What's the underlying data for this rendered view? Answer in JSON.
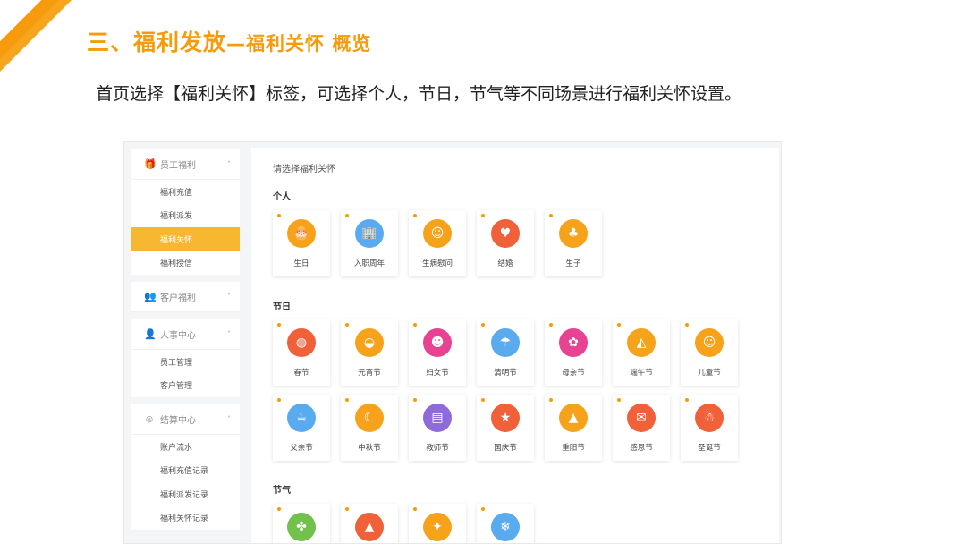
{
  "header": {
    "title_main": "三、福利发放",
    "title_sub": "—福利关怀 概览",
    "description": "首页选择【福利关怀】标签，可选择个人，节日，节气等不同场景进行福利关怀设置。"
  },
  "sidebar": {
    "groups": [
      {
        "label": "员工福利",
        "icon": "gift-icon",
        "chevron": "˄",
        "items": [
          "福利充值",
          "福利派发",
          "福利关怀",
          "福利授信"
        ]
      },
      {
        "label": "客户福利",
        "icon": "users-icon",
        "chevron": "˅",
        "items": []
      },
      {
        "label": "人事中心",
        "icon": "person-icon",
        "chevron": "˄",
        "items": [
          "员工管理",
          "客户管理"
        ]
      },
      {
        "label": "结算中心",
        "icon": "coin-icon",
        "chevron": "˄",
        "items": [
          "账户流水",
          "福利充值记录",
          "福利派发记录",
          "福利关怀记录"
        ]
      }
    ],
    "active_item": "福利关怀"
  },
  "content": {
    "prompt": "请选择福利关怀",
    "sections": [
      {
        "label": "个人",
        "cards": [
          {
            "name": "生日",
            "color": "#f7a21b",
            "glyph": "🎂"
          },
          {
            "name": "入职周年",
            "color": "#5aaaf0",
            "glyph": "🏢"
          },
          {
            "name": "生病慰问",
            "color": "#f7a21b",
            "glyph": "☺"
          },
          {
            "name": "结婚",
            "color": "#f0613a",
            "glyph": "♥"
          },
          {
            "name": "生子",
            "color": "#f7a21b",
            "glyph": "♣"
          }
        ]
      },
      {
        "label": "节日",
        "cards": [
          {
            "name": "春节",
            "color": "#f0613a",
            "glyph": "◍"
          },
          {
            "name": "元宵节",
            "color": "#f7a21b",
            "glyph": "◒"
          },
          {
            "name": "妇女节",
            "color": "#e84393",
            "glyph": "☻"
          },
          {
            "name": "清明节",
            "color": "#5aaaf0",
            "glyph": "☂"
          },
          {
            "name": "母亲节",
            "color": "#e84393",
            "glyph": "✿"
          },
          {
            "name": "端午节",
            "color": "#f7a21b",
            "glyph": "◭"
          },
          {
            "name": "儿童节",
            "color": "#f7a21b",
            "glyph": "☺"
          },
          {
            "name": "父亲节",
            "color": "#5aaaf0",
            "glyph": "☕"
          },
          {
            "name": "中秋节",
            "color": "#f7a21b",
            "glyph": "☾"
          },
          {
            "name": "教师节",
            "color": "#8e6bd8",
            "glyph": "▤"
          },
          {
            "name": "国庆节",
            "color": "#f0613a",
            "glyph": "★"
          },
          {
            "name": "重阳节",
            "color": "#f7a21b",
            "glyph": "▲"
          },
          {
            "name": "感恩节",
            "color": "#f0613a",
            "glyph": "✉"
          },
          {
            "name": "圣诞节",
            "color": "#f0613a",
            "glyph": "☃"
          }
        ]
      },
      {
        "label": "节气",
        "cards": [
          {
            "name": "",
            "color": "#72c14a",
            "glyph": "✤"
          },
          {
            "name": "",
            "color": "#f0613a",
            "glyph": "▲"
          },
          {
            "name": "",
            "color": "#f7a21b",
            "glyph": "✦"
          },
          {
            "name": "",
            "color": "#5aaaf0",
            "glyph": "❄"
          }
        ]
      }
    ]
  }
}
